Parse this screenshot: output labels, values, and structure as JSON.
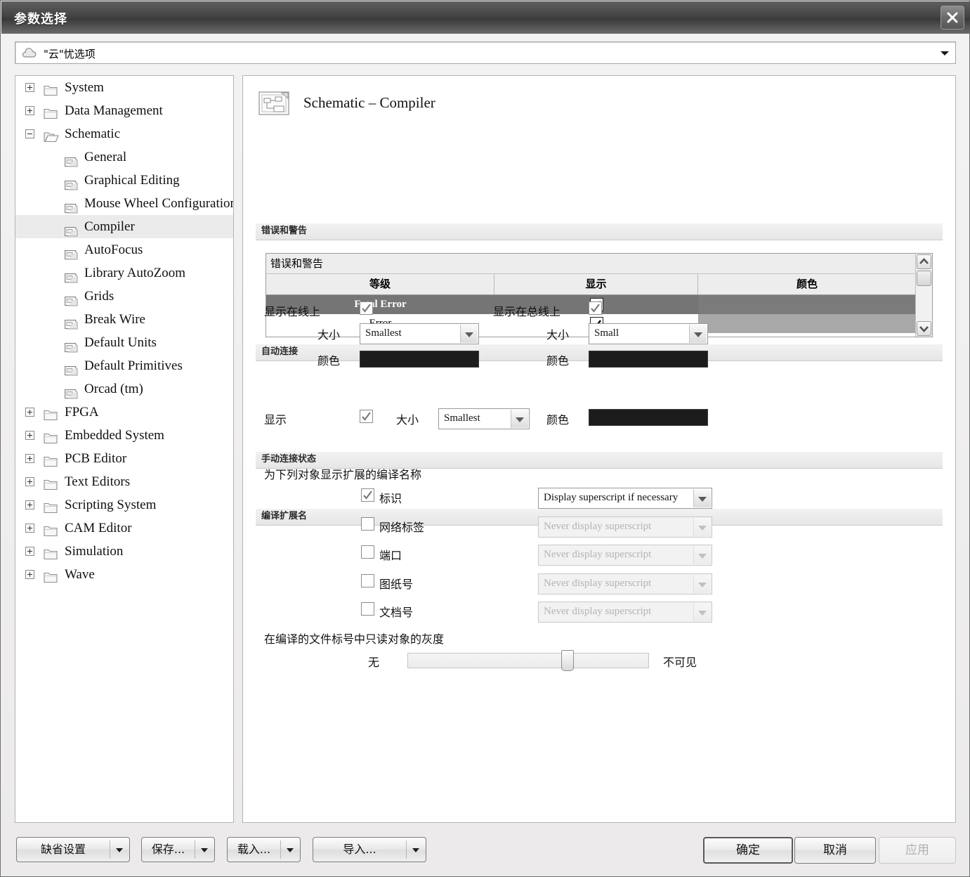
{
  "window": {
    "title": "参数选择",
    "close_label": "×"
  },
  "profile_combo": {
    "value": "\"云\"忧选项",
    "icon": "cloud-icon"
  },
  "tree": {
    "items": [
      {
        "label": "System",
        "type": "folder",
        "state": "collapsed",
        "indent": 0
      },
      {
        "label": "Data Management",
        "type": "folder",
        "state": "collapsed",
        "indent": 0
      },
      {
        "label": "Schematic",
        "type": "folder-open",
        "state": "expanded",
        "indent": 0
      },
      {
        "label": "General",
        "type": "page",
        "state": "leaf",
        "indent": 1
      },
      {
        "label": "Graphical Editing",
        "type": "page",
        "state": "leaf",
        "indent": 1
      },
      {
        "label": "Mouse Wheel Configuration",
        "type": "page",
        "state": "leaf",
        "indent": 1
      },
      {
        "label": "Compiler",
        "type": "page",
        "state": "leaf",
        "indent": 1,
        "selected": true
      },
      {
        "label": "AutoFocus",
        "type": "page",
        "state": "leaf",
        "indent": 1
      },
      {
        "label": "Library AutoZoom",
        "type": "page",
        "state": "leaf",
        "indent": 1
      },
      {
        "label": "Grids",
        "type": "page",
        "state": "leaf",
        "indent": 1
      },
      {
        "label": "Break Wire",
        "type": "page",
        "state": "leaf",
        "indent": 1
      },
      {
        "label": "Default Units",
        "type": "page",
        "state": "leaf",
        "indent": 1
      },
      {
        "label": "Default Primitives",
        "type": "page",
        "state": "leaf",
        "indent": 1
      },
      {
        "label": "Orcad (tm)",
        "type": "page",
        "state": "leaf",
        "indent": 1
      },
      {
        "label": "FPGA",
        "type": "folder",
        "state": "collapsed",
        "indent": 0
      },
      {
        "label": "Embedded System",
        "type": "folder",
        "state": "collapsed",
        "indent": 0
      },
      {
        "label": "PCB Editor",
        "type": "folder",
        "state": "collapsed",
        "indent": 0
      },
      {
        "label": "Text Editors",
        "type": "folder",
        "state": "collapsed",
        "indent": 0
      },
      {
        "label": "Scripting System",
        "type": "folder",
        "state": "collapsed",
        "indent": 0
      },
      {
        "label": "CAM Editor",
        "type": "folder",
        "state": "collapsed",
        "indent": 0
      },
      {
        "label": "Simulation",
        "type": "folder",
        "state": "collapsed",
        "indent": 0
      },
      {
        "label": "Wave",
        "type": "folder",
        "state": "collapsed",
        "indent": 0
      }
    ]
  },
  "page": {
    "title": "Schematic – Compiler",
    "icon": "schematic-document-icon"
  },
  "errors_section": {
    "header": "错误和警告",
    "grid_title": "错误和警告",
    "columns": [
      "等级",
      "显示",
      "颜色"
    ],
    "rows": [
      {
        "level": "Fatal Error",
        "show": true,
        "color": "#7b7b7b",
        "selected": true
      },
      {
        "level": "Error",
        "show": true,
        "color": "#a8a8a8",
        "selected": false
      }
    ]
  },
  "auto_connect": {
    "header": "自动连接",
    "on_wire": {
      "label": "显示在线上",
      "checked": true,
      "size_label": "大小",
      "size_value": "Smallest",
      "color_label": "颜色",
      "color_value": "#1c1c1c"
    },
    "on_bus": {
      "label": "显示在总线上",
      "checked": true,
      "size_label": "大小",
      "size_value": "Small",
      "color_label": "颜色",
      "color_value": "#1c1c1c"
    }
  },
  "manual_connect": {
    "header": "手动连接状态",
    "show_label": "显示",
    "checked": true,
    "size_label": "大小",
    "size_value": "Smallest",
    "color_label": "颜色",
    "color_value": "#1c1c1c"
  },
  "compiled_names": {
    "header": "编译扩展名",
    "intro": "为下列对象显示扩展的编译名称",
    "rows": [
      {
        "label": "标识",
        "checked": true,
        "option": "Display superscript if necessary",
        "enabled": true
      },
      {
        "label": "网络标签",
        "checked": false,
        "option": "Never display superscript",
        "enabled": false
      },
      {
        "label": "端口",
        "checked": false,
        "option": "Never display superscript",
        "enabled": false
      },
      {
        "label": "图纸号",
        "checked": false,
        "option": "Never display superscript",
        "enabled": false
      },
      {
        "label": "文档号",
        "checked": false,
        "option": "Never display superscript",
        "enabled": false
      }
    ],
    "fade_label": "在编译的文件标号中只读对象的灰度",
    "slider": {
      "min_label": "无",
      "max_label": "不可见",
      "percent": 67
    }
  },
  "footer": {
    "left_buttons": [
      {
        "label": "缺省设置",
        "has_dropdown": true
      },
      {
        "label": "保存...",
        "has_dropdown": true
      },
      {
        "label": "载入...",
        "has_dropdown": true
      },
      {
        "label": "导入...",
        "has_dropdown": true
      }
    ],
    "ok": "确定",
    "cancel": "取消",
    "apply": "应用"
  }
}
